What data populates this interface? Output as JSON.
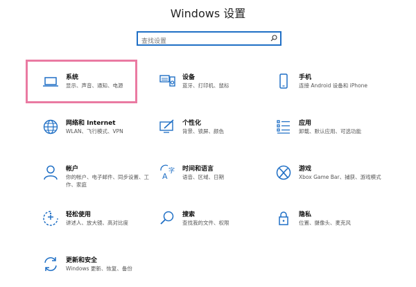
{
  "window": {
    "title": "Windows 设置"
  },
  "search": {
    "placeholder": "查找设置"
  },
  "colors": {
    "accent": "#1f6fc5",
    "highlight": "#ea7aa2"
  },
  "tiles": [
    {
      "name": "系统",
      "desc": "显示、声音、通知、电源",
      "icon": "laptop-icon"
    },
    {
      "name": "设备",
      "desc": "蓝牙、打印机、鼠标",
      "icon": "keyboard-speaker-icon"
    },
    {
      "name": "手机",
      "desc": "连接 Android 设备和 iPhone",
      "icon": "phone-icon"
    },
    {
      "name": "网络和 Internet",
      "desc": "WLAN、飞行模式、VPN",
      "icon": "globe-icon"
    },
    {
      "name": "个性化",
      "desc": "背景、锁屏、颜色",
      "icon": "pen-monitor-icon"
    },
    {
      "name": "应用",
      "desc": "卸载、默认应用、可选功能",
      "icon": "apps-list-icon"
    },
    {
      "name": "帐户",
      "desc": "你的帐户、电子邮件、同步设置、工作、家庭",
      "icon": "person-icon"
    },
    {
      "name": "时间和语言",
      "desc": "语音、区域、日期",
      "icon": "time-language-icon"
    },
    {
      "name": "游戏",
      "desc": "Xbox Game Bar、捕获、游戏模式",
      "icon": "xbox-icon"
    },
    {
      "name": "轻松使用",
      "desc": "讲述人、放大镜、高对比度",
      "icon": "ease-of-access-icon"
    },
    {
      "name": "搜索",
      "desc": "查找我的文件、权限",
      "icon": "search-icon"
    },
    {
      "name": "隐私",
      "desc": "位置、摄像头、麦克风",
      "icon": "lock-icon"
    },
    {
      "name": "更新和安全",
      "desc": "Windows 更新、恢复、备份",
      "icon": "sync-icon"
    }
  ]
}
